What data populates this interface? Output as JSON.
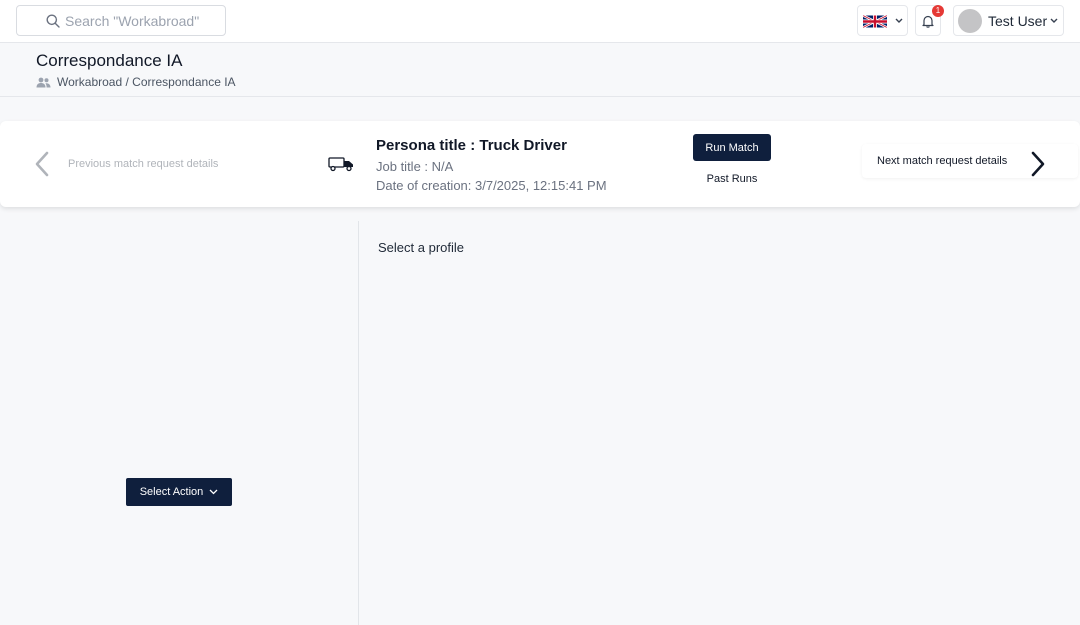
{
  "header": {
    "search": {
      "placeholder": "Search \"Workabroad\"",
      "value": ""
    },
    "language": {
      "flag": "uk-flag-icon"
    },
    "notifications": {
      "count": "1"
    },
    "user": {
      "name": "Test User"
    }
  },
  "page": {
    "title": "Correspondance IA",
    "breadcrumb": "Workabroad / Correspondance IA"
  },
  "match_card": {
    "previous_label": "Previous match request details",
    "next_label": "Next match request details",
    "persona_title": "Persona title : Truck Driver",
    "job_title": "Job title : N/A",
    "date_of_creation": "Date of creation: 3/7/2025, 12:15:41 PM",
    "run_match_label": "Run Match",
    "past_runs_label": "Past Runs"
  },
  "left_panel": {
    "select_action_label": "Select Action"
  },
  "right_panel": {
    "empty_message": "Select a profile"
  },
  "colors": {
    "primary_navy": "#0f1f3d",
    "background": "#f7f8fa",
    "badge_red": "#e53935"
  }
}
